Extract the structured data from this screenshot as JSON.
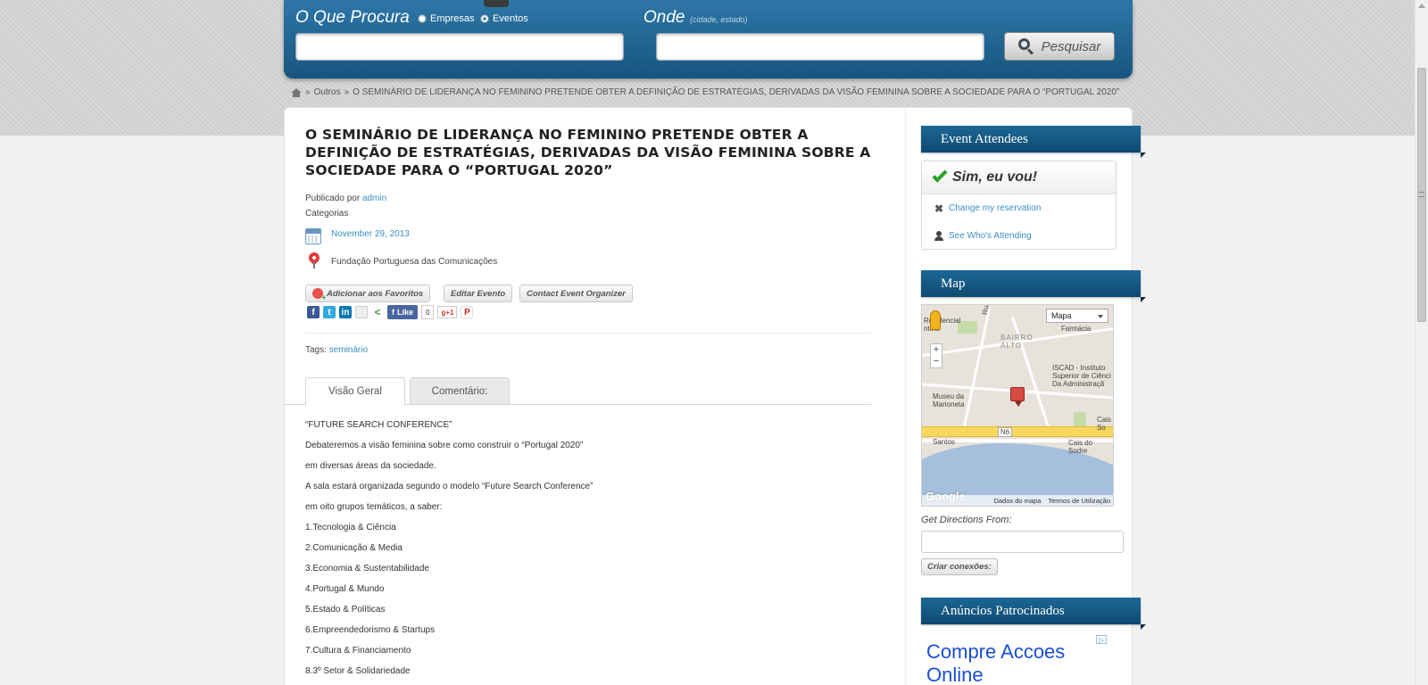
{
  "search": {
    "what_label": "O Que Procura",
    "options": [
      {
        "label": "Empresas",
        "selected": false
      },
      {
        "label": "Eventos",
        "selected": true
      }
    ],
    "where_label": "Onde",
    "where_hint": "(cidade, estado)",
    "what_value": "",
    "where_value": "",
    "button_label": "Pesquisar"
  },
  "breadcrumb": {
    "sep": "»",
    "category": "Outros",
    "current": "O SEMINÁRIO DE LIDERANÇA NO FEMININO PRETENDE OBTER A DEFINIÇÃO DE ESTRATÉGIAS, DERIVADAS DA VISÃO FEMININA SOBRE A SOCIEDADE PARA O “PORTUGAL 2020”"
  },
  "post": {
    "title": "O SEMINÁRIO DE LIDERANÇA NO FEMININO PRETENDE OBTER A DEFINIÇÃO DE ESTRATÉGIAS, DERIVADAS DA VISÃO FEMININA SOBRE A SOCIEDADE PARA O “PORTUGAL 2020”",
    "published_by_label": "Publicado por",
    "author": "admin",
    "categories_label": "Categorias",
    "date": "November 29, 2013",
    "location": "Fundação Portuguesa das Comunicações",
    "actions": {
      "favorites": "Adicionar aos Favoritos",
      "edit": "Editar Evento",
      "contact": "Contact Event Organizer"
    },
    "share": {
      "like_label": "Like",
      "like_count": "0",
      "gplus_label": "g+1"
    },
    "tags_label": "Tags:",
    "tag": "seminário",
    "tabs": [
      "Visão Geral",
      "Comentário:"
    ],
    "body": [
      "“FUTURE SEARCH CONFERENCE”",
      "Debateremos a visão feminina sobre como construir o “Portugal 2020”",
      "em diversas áreas da sociedade.",
      "A sala estará organizada segundo o modelo “Future Search Conference”",
      "em oito grupos temáticos, a saber:",
      "1.Tecnologia & Ciência",
      "2.Comunicação & Media",
      "3.Economia & Sustentabilidade",
      "4.Portugal & Mundo",
      "5.Estado & Políticas",
      "6.Empreendedorismo & Startups",
      "7.Cultura & Financiamento",
      "8.3º Setor & Solidariedade"
    ]
  },
  "sidebar": {
    "attendees": {
      "title": "Event Attendees",
      "status": "Sim, eu vou!",
      "change_link": "Change my reservation",
      "see_link": "See Who's Attending"
    },
    "map": {
      "title": "Map",
      "type_label": "Mapa",
      "labels": {
        "residencial": "Residencial\nntina",
        "rua_paz": "Rua Paz",
        "farmacia": "Farmácia",
        "bairro": "BAIRRO\nALTO",
        "iscad": "ISCAD - Instituto\nSuperior de Ciênci\nDa Administraçã",
        "museu": "Museu da\nMarioneta",
        "cais": "Cais\nSo",
        "n6": "N6",
        "santos": "Santos",
        "cais_sodre": "Cais do\nSodre"
      },
      "google": "Google",
      "footer_data": "Dados do mapa",
      "footer_terms": "Termos de Utilização",
      "directions_label": "Get Directions From:",
      "directions_value": "",
      "directions_button": "Criar conexões:"
    },
    "ads": {
      "title": "Anúncios Patrocinados",
      "text": "Compre Accoes Online",
      "badge": "▷"
    }
  },
  "colors": {
    "header_blue": "#1b6796",
    "link_blue": "#3a8fc4",
    "ad_blue": "#1a4fd6"
  }
}
